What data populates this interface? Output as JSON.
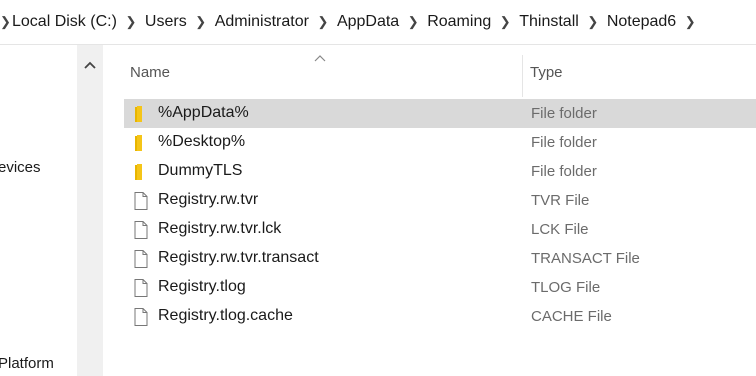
{
  "breadcrumb": {
    "items": [
      "Local Disk (C:)",
      "Users",
      "Administrator",
      "AppData",
      "Roaming",
      "Thinstall",
      "Notepad6"
    ]
  },
  "nav": {
    "items": [
      "evices",
      "Platform"
    ]
  },
  "list": {
    "columns": {
      "name": "Name",
      "type": "Type"
    },
    "rows": [
      {
        "name": "%AppData%",
        "type": "File folder",
        "icon": "folder-icon",
        "selected": true
      },
      {
        "name": "%Desktop%",
        "type": "File folder",
        "icon": "folder-icon",
        "selected": false
      },
      {
        "name": "DummyTLS",
        "type": "File folder",
        "icon": "folder-icon",
        "selected": false
      },
      {
        "name": "Registry.rw.tvr",
        "type": "TVR File",
        "icon": "file-icon",
        "selected": false
      },
      {
        "name": "Registry.rw.tvr.lck",
        "type": "LCK File",
        "icon": "file-icon",
        "selected": false
      },
      {
        "name": "Registry.rw.tvr.transact",
        "type": "TRANSACT File",
        "icon": "file-icon",
        "selected": false
      },
      {
        "name": "Registry.tlog",
        "type": "TLOG File",
        "icon": "file-icon",
        "selected": false
      },
      {
        "name": "Registry.tlog.cache",
        "type": "CACHE File",
        "icon": "file-icon",
        "selected": false
      }
    ]
  },
  "colors": {
    "selection": "#d9d9d9",
    "folder": "#f5c518",
    "scrollbar": "#f0f0f0"
  }
}
